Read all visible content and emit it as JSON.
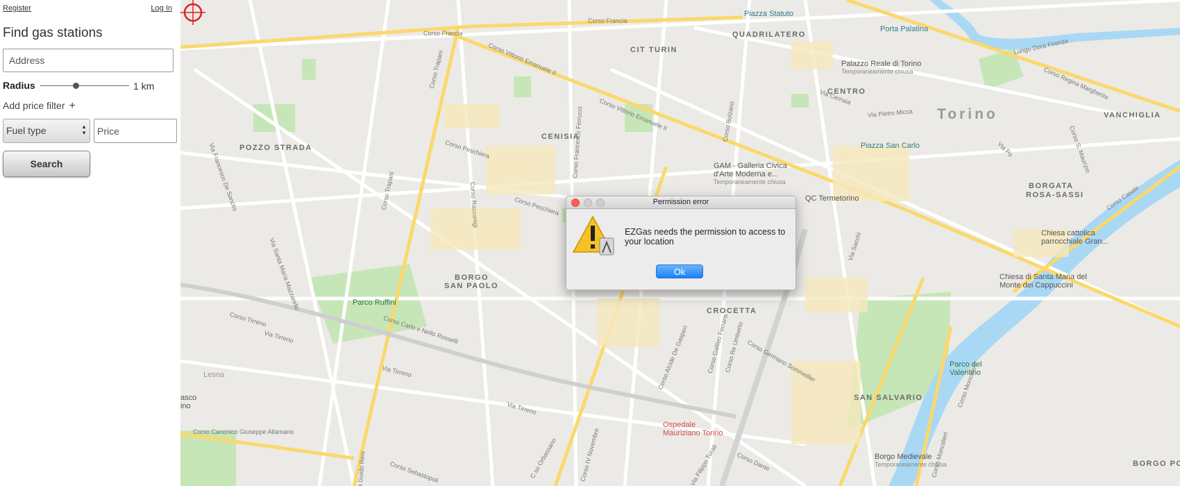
{
  "nav": {
    "register": "Register",
    "login": "Log In"
  },
  "sidebar": {
    "title": "Find gas stations",
    "address_placeholder": "Address",
    "radius_label": "Radius",
    "radius_value": "1 km",
    "radius_slider_fraction": 0.4,
    "add_price_filter": "Add price filter",
    "plus": "+",
    "fuel_type": "Fuel type",
    "price_placeholder": "Price",
    "search": "Search"
  },
  "map": {
    "city": "Torino",
    "districts": [
      "QUADRILATERO",
      "CIT TURIN",
      "CENTRO",
      "VANCHIGLIA",
      "POZZO STRADA",
      "CENISIA",
      "BORGATA",
      "ROSA-SASSI",
      "BORGO",
      "SAN PAOLO",
      "CROCETTA",
      "SAN SALVARIO",
      "BORGO PO",
      "Lesna"
    ],
    "pois": {
      "piazza_statuto": "Piazza Statuto",
      "porta_palatina": "Porta Palatina",
      "palazzo_reale": "Palazzo Reale di Torino",
      "palazzo_reale_sub": "Temporaneamente chiusa",
      "piazza_san_carlo": "Piazza San Carlo",
      "gam": "GAM - Galleria Civica",
      "gam2": "d'Arte Moderna e...",
      "gam_sub": "Temporaneamente chiusa",
      "qc": "QC Termetorino",
      "parco_ruffini": "Parco Ruffini",
      "chiesa_cattolica": "Chiesa cattolica",
      "chiesa_cattolica2": "parrocchiale Gran...",
      "chiesa_cappuccini": "Chiesa di Santa Maria del",
      "chiesa_cappuccini2": "Monte dei Cappuccini",
      "parco_valentino": "Parco del",
      "parco_valentino2": "Valentino",
      "ospedale": "Ospedale",
      "ospedale2": "Mauriziano Torino",
      "borgo_medievale": "Borgo Medievale",
      "borgo_medievale_sub": "Temporaneamente chiusa",
      "asco": "asco",
      "ino": "ino"
    },
    "streets": {
      "corso_francia": "Corso Francia",
      "corso_vittorio": "Corso Vittorio Emanuele II",
      "corso_trapani": "Corso Trapani",
      "corso_peschiera": "Corso Peschiera",
      "corso_ferrucci": "Corso Francesco Ferrucci",
      "corso_racconigi": "Corso Racconigi",
      "corso_carlo": "Corso Carlo e Nello Rosselli",
      "via_tirreno": "Via Tirreno",
      "corso_tirreno": "Corso Tirreno",
      "corso_allamano": "Corso Canonico Giuseppe Allamano",
      "corso_orbassano": "C.so Orbassano",
      "corso_novembre": "Corso IV Novembre",
      "corso_de_gasperi": "Corso Alcide De Gasperi",
      "corso_galilei": "Corso Galileo Ferraris",
      "corso_re_umberto": "Corso Re Umberto",
      "corso_sommeiller": "Corso Germano Sommeiller",
      "corso_moncalieri": "Corso Moncalieri",
      "corso_dante": "Corso Dante",
      "via_filippo_turati": "Via Filippo Turati",
      "corso_regina": "Corso Regina Margherita",
      "lungo_dora": "Lungo Dora Firenze",
      "corso_casale": "Corso Casale",
      "via_sacchi": "Via Sacchi",
      "via_santa_maria": "Via Santa Maria Mazzarello",
      "via_de_sanctis": "Via Francesco De Sanctis",
      "via_pietro_micca": "Via Pietro Micca",
      "via_cernaia": "Via Cernaia",
      "corso_bolzano": "Corso Bolzano",
      "via_guido_reni": "Via Guido Reni",
      "corso_sebastopoli": "Corso Sebastopoli",
      "via_po": "Via Po",
      "corso_s_maurizio": "Corso S. Maurizio"
    }
  },
  "dialog": {
    "title": "Permission error",
    "message": "EZGas needs the permission to access to your location",
    "ok": "Ok"
  },
  "colors": {
    "map_bg": "#eceae6",
    "road": "#ffffff",
    "main_road": "#fbd86b",
    "park": "#c6e6b8",
    "river": "#a9d8f4",
    "dialog_ok": "#1a82f7"
  }
}
